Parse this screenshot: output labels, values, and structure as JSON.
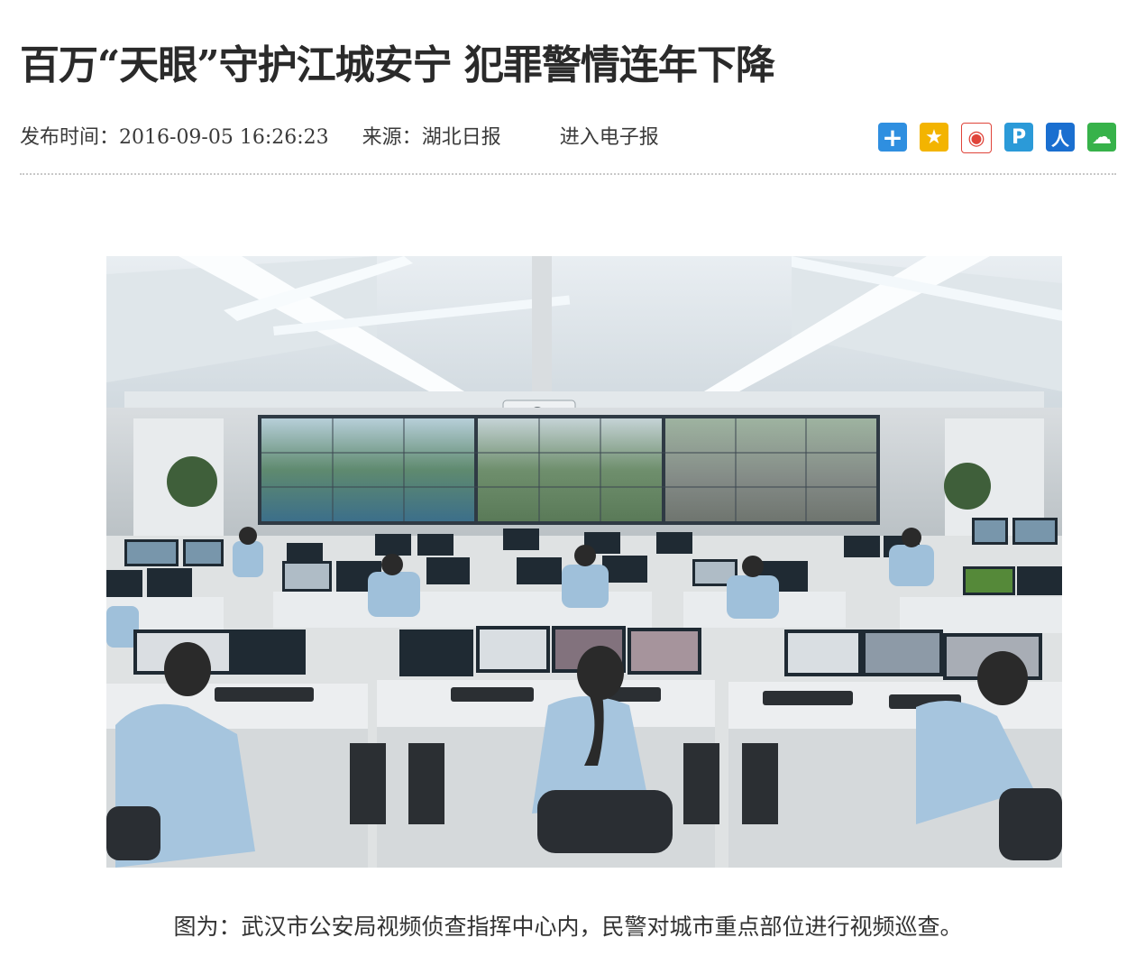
{
  "article": {
    "title": "百万“天眼”守护江城安宁 犯罪警情连年下降",
    "meta": {
      "published_label": "发布时间：",
      "published_value": "2016-09-05 16:26:23",
      "source_label": "来源：",
      "source_value": "湖北日报",
      "epaper_link": "进入电子报"
    },
    "caption": "图为：武汉市公安局视频侦查指挥中心内，民警对城市重点部位进行视频巡查。"
  },
  "share": {
    "icons": [
      {
        "name": "share-more-icon",
        "glyph": "+",
        "color": "#2f8fe0"
      },
      {
        "name": "qzone-icon",
        "glyph": "★",
        "color": "#f3b400"
      },
      {
        "name": "weibo-icon",
        "glyph": "◉",
        "color": "#e0443a"
      },
      {
        "name": "tencent-weibo-icon",
        "glyph": "P",
        "color": "#2b9ad8"
      },
      {
        "name": "renren-icon",
        "glyph": "人",
        "color": "#1a6fd0"
      },
      {
        "name": "wechat-icon",
        "glyph": "☁",
        "color": "#37b24a"
      }
    ]
  }
}
